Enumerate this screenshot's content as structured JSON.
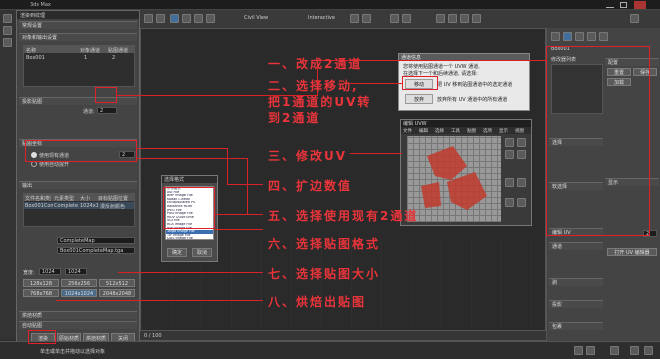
{
  "app": {
    "title": "3ds Max",
    "menu": [
      "Civil View",
      "Interactive"
    ]
  },
  "render_to_texture": {
    "title": "渲染到纹理",
    "sections": [
      "常规设置",
      "对象和输出设置",
      "烘焙对象",
      "投影贴图",
      "贴图坐标",
      "输出",
      "烘焙材质",
      "自动贴图"
    ],
    "objects_header": [
      "名称",
      "对象通道",
      "贴图通道"
    ],
    "object_row": [
      "Box001",
      "1",
      "2"
    ],
    "uv_channel_label": "通道:",
    "uv_channel_value": "2",
    "existing_channel_label": "使用现有通道",
    "auto_unwrap_label": "使用自动展开",
    "output_cols": [
      "文件名和类型",
      "元素类型",
      "大小",
      "目标贴图位置"
    ],
    "output_row": [
      "Box001Complete...",
      "CompleteMap",
      "1024x1024",
      "漫反射颜色"
    ],
    "name_field": "CompleteMap",
    "filename_field": "Box001CompleteMap.tga",
    "size_label": "宽度:",
    "size_values": [
      "1024",
      "1024"
    ],
    "size_buttons": [
      "128x128",
      "256x256",
      "512x512",
      "768x768",
      "1024x1024",
      "2048x2048"
    ],
    "render_button": "渲染",
    "bottom_buttons": [
      "原始材质",
      "烘焙材质",
      "关闭"
    ],
    "status": "单击或单击并拖动以选择对象"
  },
  "format_dialog": {
    "title": "选择格式",
    "items": [
      "所有格式",
      "AVI File",
      "BMP Image File",
      "Kodak Cineon",
      "Encapsulated PS",
      "Radiance HDRI",
      "JPEG File",
      "PNG Image File",
      "MOV QuickTime",
      "SGI File",
      "RLA Image File",
      "RPF Image File",
      "Targa Image File",
      "TIF Image File",
      "DDS Image File"
    ],
    "ok": "确定",
    "cancel": "取消"
  },
  "channel_dialog": {
    "title": "通道信息",
    "text_line1": "您将使用贴图通道一个 UVW 通道,",
    "text_line2": "在选择下一个和后续通道, 请选择:",
    "move_button": "移动",
    "move_desc": "把 UV 移到贴图通道中的选定通道",
    "abandon_button": "放弃",
    "abandon_desc": "放弃所有 UV 通道中的所有通道"
  },
  "uv_editor": {
    "title": "编辑 UVW",
    "menu": [
      "文件",
      "编辑",
      "选择",
      "工具",
      "贴图",
      "选项",
      "显示",
      "视图"
    ]
  },
  "command_panel": {
    "labels": [
      "修改器列表",
      "Box001",
      "选择",
      "软选择",
      "编辑 UV",
      "通道",
      "剥",
      "投影",
      "包裹",
      "配置",
      "重置 UVW",
      "保存",
      "加载",
      "显示",
      "打开 UV 编辑器"
    ],
    "channel_value": "2"
  },
  "timeline": {
    "frame": "0 / 100"
  },
  "annotations": [
    "一、改成2通道",
    "二、选择移动,",
    "把1通道的UV转",
    "到2通道",
    "三、修改UV",
    "四、扩边数值",
    "五、选择使用现有2通道",
    "六、选择贴图格式",
    "七、选择贴图大小",
    "八、烘焙出贴图"
  ],
  "colors": {
    "accent_red": "#d82027",
    "uv_red": "#c0392b",
    "panel_bg": "#444444",
    "viewport_bg": "#2a2a2a"
  }
}
